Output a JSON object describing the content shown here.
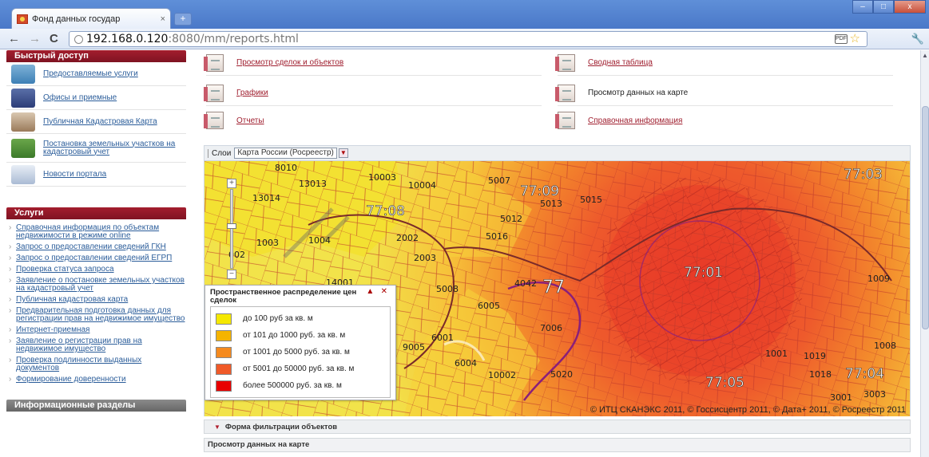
{
  "browser": {
    "tab_title": "Фонд данных государ",
    "url_host": "192.168.0.120",
    "url_rest": ":8080/mm/reports.html",
    "new_tab_label": "+",
    "close_glyph": "×",
    "back_glyph": "←",
    "forward_glyph": "→",
    "reload_glyph": "C",
    "star_glyph": "☆",
    "ext_label": "PDF",
    "wrench_glyph": "🔧",
    "win_min": "–",
    "win_max": "□",
    "win_close": "x"
  },
  "sidebar": {
    "quick_access_title": "Быстрый доступ",
    "quick_items": [
      {
        "label": "Предоставляемые услуги",
        "icon": "globe-user-icon"
      },
      {
        "label": "Офисы и приемные",
        "icon": "office-building-icon"
      },
      {
        "label": "Публичная Кадастровая Карта",
        "icon": "map-pin-icon"
      },
      {
        "label": "Постановка земельных участков на кадастровый учет",
        "icon": "tree-land-icon"
      },
      {
        "label": "Новости портала",
        "icon": "news-icon"
      }
    ],
    "services_title": "Услуги",
    "services": [
      "Справочная информация по объектам недвижимости в режиме online",
      "Запрос о предоставлении сведений ГКН",
      "Запрос о предоставлении сведений ЕГРП",
      "Проверка статуса запроса",
      "Заявление о постановке земельных участков на кадастровый учет",
      "Публичная кадастровая карта",
      "Предварительная подготовка данных для регистрации прав на недвижимое имущество",
      "Интернет-приемная",
      "Заявление о регистрации прав на недвижимое имущество",
      "Проверка подлинности выданных документов",
      "Формирование доверенности"
    ],
    "info_title": "Информационные разделы"
  },
  "links": [
    {
      "label": "Просмотр сделок и объектов",
      "active": true
    },
    {
      "label": "Сводная таблица",
      "active": true
    },
    {
      "label": "Графики",
      "active": true
    },
    {
      "label": "Просмотр данных на карте",
      "active": false
    },
    {
      "label": "Отчеты",
      "active": true
    },
    {
      "label": "Справочная информация",
      "active": true
    }
  ],
  "map": {
    "layers_label": "Слои",
    "layer_value": "Карта России (Росреестр)",
    "zoom_in": "+",
    "zoom_out": "−",
    "labels": [
      "8010",
      "13013",
      "10003",
      "10004",
      "5007",
      "77:09",
      "5013",
      "5015",
      "77:03",
      "13014",
      "77:08",
      "5012",
      "5016",
      "1003",
      "1004",
      "2002",
      "2003",
      "002",
      "14001",
      "5008",
      "4042",
      "77",
      "6005",
      "77:01",
      "1009",
      "7006",
      "6001",
      "9005",
      "6004",
      "1001",
      "1019",
      "1008",
      "10002",
      "5020",
      "1018",
      "77:04",
      "77:05",
      "3001",
      "3003"
    ],
    "copyright": "© ИТЦ СКАНЭКС 2011, © Госсисцентр 2011, © Дата+ 2011, © Росреестр 2011"
  },
  "legend": {
    "title": "Пространственное распределение цен сделок",
    "collapse_glyph": "▲",
    "close_glyph": "✕",
    "items": [
      {
        "label": "до 100 руб за кв. м",
        "color": "#f5e800"
      },
      {
        "label": "от 101 до 1000 руб. за кв. м",
        "color": "#f5b400"
      },
      {
        "label": "от 1001 до 5000 руб. за кв. м",
        "color": "#f58a1e"
      },
      {
        "label": "от 5001 до 50000 руб. за кв. м",
        "color": "#f05a28"
      },
      {
        "label": "более 500000 руб. за кв. м",
        "color": "#e80000"
      }
    ]
  },
  "filter": {
    "glyph": "▼",
    "label": "Форма фильтрации объектов"
  },
  "view_title": "Просмотр данных на карте"
}
